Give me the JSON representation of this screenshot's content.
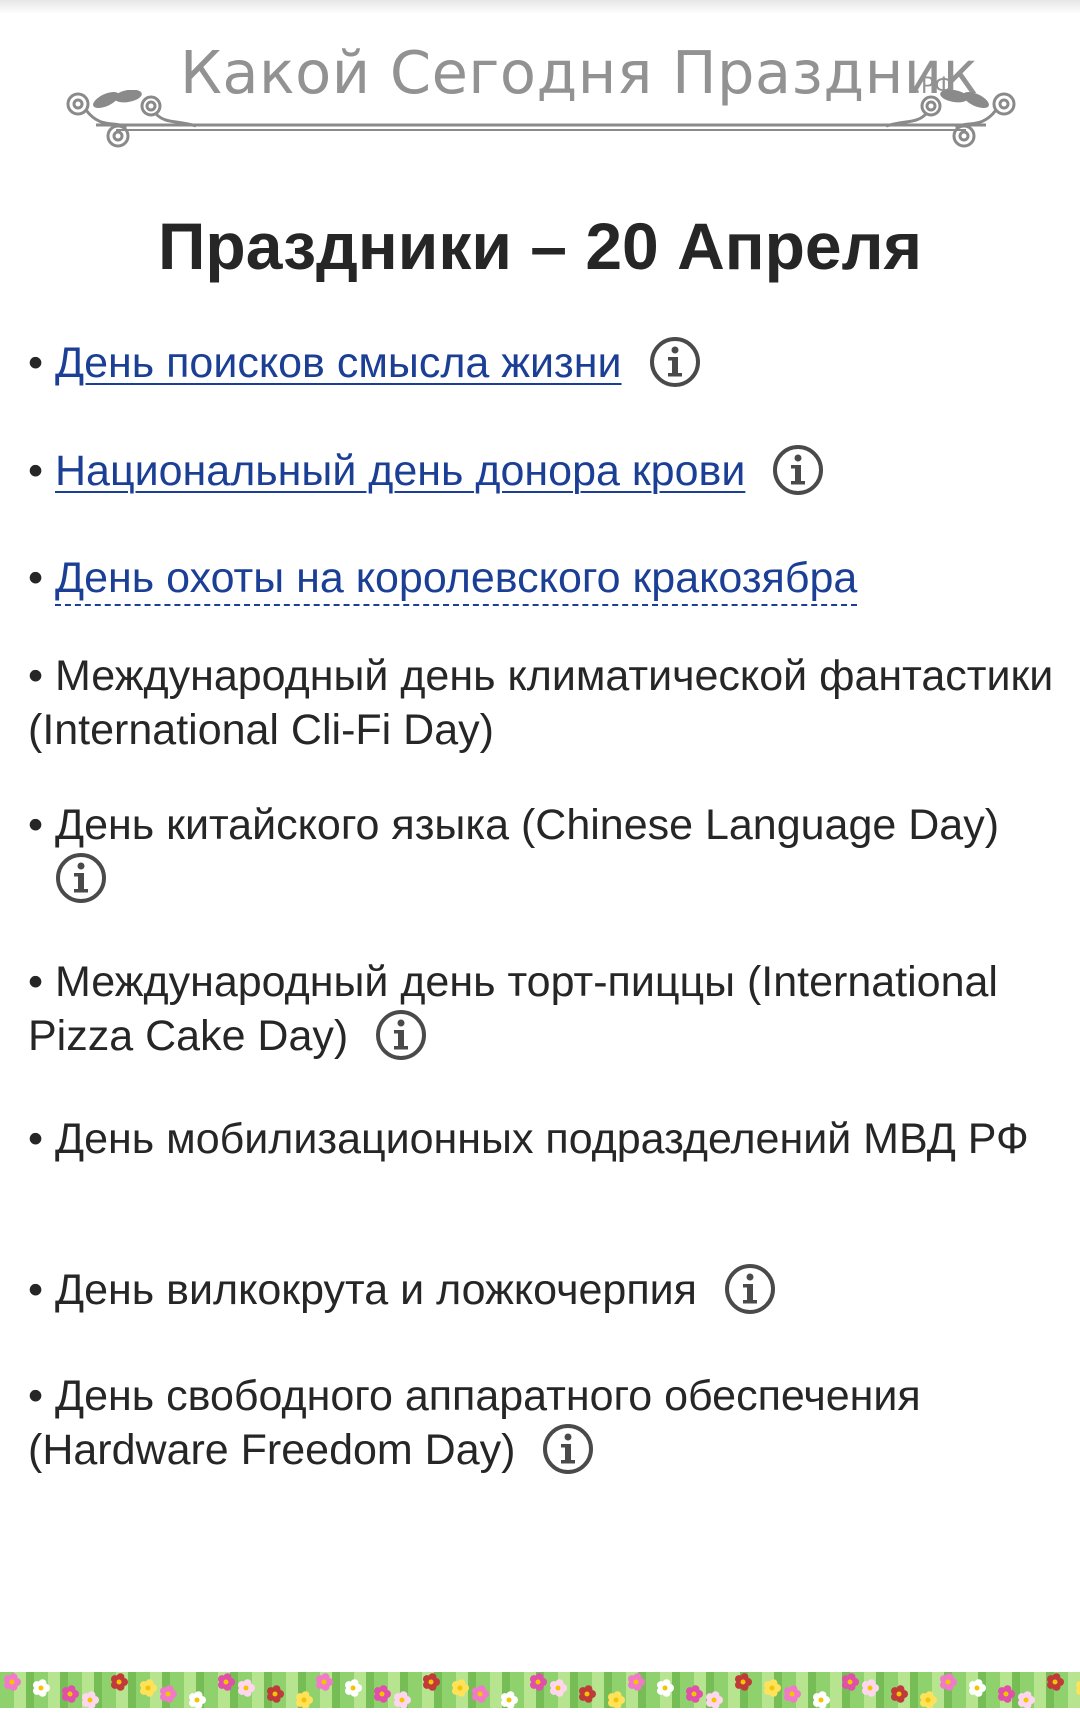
{
  "site": {
    "logo_text": "Какой Сегодня Праздник",
    "logo_suffix": ".РФ"
  },
  "page": {
    "title": "Праздники – 20 Апреля"
  },
  "holidays": [
    {
      "bullet": "•",
      "text": "День поисков смысла жизни",
      "is_link": true,
      "link_style": "underline",
      "has_info": true
    },
    {
      "bullet": "•",
      "text": "Национальный день донора крови",
      "is_link": true,
      "link_style": "underline",
      "has_info": true
    },
    {
      "bullet": "•",
      "text": "День охоты на королевского кракозябра",
      "is_link": true,
      "link_style": "dashed",
      "has_info": false
    },
    {
      "bullet": "•",
      "text": "Международный день климатической фантастики (International Cli-Fi Day)",
      "is_link": false,
      "has_info": false
    },
    {
      "bullet": "•",
      "text": "День китайского языка (Chinese Language Day)",
      "is_link": false,
      "has_info": true
    },
    {
      "bullet": "•",
      "text": "Международный день торт-пиццы (International Pizza Cake Day)",
      "is_link": false,
      "has_info": true
    },
    {
      "bullet": "•",
      "text": "День мобилизационных подразделений МВД РФ",
      "is_link": false,
      "has_info": false
    },
    {
      "bullet": "•",
      "text": "День вилкокрута и ложкочерпия",
      "is_link": false,
      "has_info": true
    },
    {
      "bullet": "•",
      "text": "День свободного аппаратного обеспечения (Hardware Freedom Day)",
      "is_link": false,
      "has_info": true
    }
  ],
  "icons": {
    "info": "info-circle-icon",
    "ornament": "leaf-scroll-ornament",
    "border": "flower-border"
  },
  "colors": {
    "link": "#1c3f96",
    "text": "#262626",
    "logo": "#929292"
  }
}
